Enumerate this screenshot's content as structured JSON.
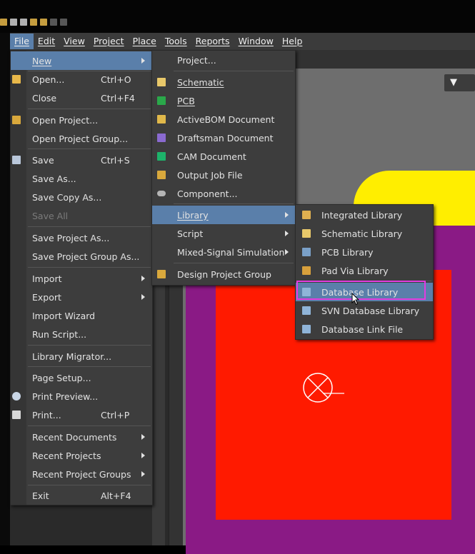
{
  "menubar": {
    "items": [
      "File",
      "Edit",
      "View",
      "Project",
      "Place",
      "Tools",
      "Reports",
      "Window",
      "Help"
    ],
    "active": "File"
  },
  "file_menu": {
    "items": [
      {
        "label": "New",
        "shortcut": "",
        "submenu": true,
        "icon": "",
        "disabled": false
      },
      {
        "label": "Open...",
        "shortcut": "Ctrl+O",
        "submenu": false,
        "icon": "open-folder-icon",
        "disabled": false
      },
      {
        "label": "Close",
        "shortcut": "Ctrl+F4",
        "submenu": false,
        "icon": "",
        "disabled": false
      },
      {
        "label": "Open Project...",
        "shortcut": "",
        "submenu": false,
        "icon": "open-project-icon",
        "disabled": false
      },
      {
        "label": "Open Project Group...",
        "shortcut": "",
        "submenu": false,
        "icon": "",
        "disabled": false
      },
      {
        "label": "Save",
        "shortcut": "Ctrl+S",
        "submenu": false,
        "icon": "save-disk-icon",
        "disabled": false
      },
      {
        "label": "Save As...",
        "shortcut": "",
        "submenu": false,
        "icon": "",
        "disabled": false
      },
      {
        "label": "Save Copy As...",
        "shortcut": "",
        "submenu": false,
        "icon": "",
        "disabled": false
      },
      {
        "label": "Save All",
        "shortcut": "",
        "submenu": false,
        "icon": "",
        "disabled": true
      },
      {
        "label": "Save Project As...",
        "shortcut": "",
        "submenu": false,
        "icon": "",
        "disabled": false
      },
      {
        "label": "Save Project Group As...",
        "shortcut": "",
        "submenu": false,
        "icon": "",
        "disabled": false
      },
      {
        "label": "Import",
        "shortcut": "",
        "submenu": true,
        "icon": "",
        "disabled": false
      },
      {
        "label": "Export",
        "shortcut": "",
        "submenu": true,
        "icon": "",
        "disabled": false
      },
      {
        "label": "Import Wizard",
        "shortcut": "",
        "submenu": false,
        "icon": "",
        "disabled": false
      },
      {
        "label": "Run Script...",
        "shortcut": "",
        "submenu": false,
        "icon": "",
        "disabled": false
      },
      {
        "label": "Library Migrator...",
        "shortcut": "",
        "submenu": false,
        "icon": "",
        "disabled": false
      },
      {
        "label": "Page Setup...",
        "shortcut": "",
        "submenu": false,
        "icon": "",
        "disabled": false
      },
      {
        "label": "Print Preview...",
        "shortcut": "",
        "submenu": false,
        "icon": "print-preview-icon",
        "disabled": false
      },
      {
        "label": "Print...",
        "shortcut": "Ctrl+P",
        "submenu": false,
        "icon": "printer-icon",
        "disabled": false
      },
      {
        "label": "Recent Documents",
        "shortcut": "",
        "submenu": true,
        "icon": "",
        "disabled": false
      },
      {
        "label": "Recent Projects",
        "shortcut": "",
        "submenu": true,
        "icon": "",
        "disabled": false
      },
      {
        "label": "Recent Project Groups",
        "shortcut": "",
        "submenu": true,
        "icon": "",
        "disabled": false
      },
      {
        "label": "Exit",
        "shortcut": "Alt+F4",
        "submenu": false,
        "icon": "",
        "disabled": false
      }
    ]
  },
  "new_menu": {
    "items": [
      {
        "label": "Project...",
        "submenu": false,
        "icon": ""
      },
      {
        "label": "Schematic",
        "submenu": false,
        "icon": "schematic-icon"
      },
      {
        "label": "PCB",
        "submenu": false,
        "icon": "pcb-icon"
      },
      {
        "label": "ActiveBOM Document",
        "submenu": false,
        "icon": "activebom-icon"
      },
      {
        "label": "Draftsman Document",
        "submenu": false,
        "icon": "draftsman-icon"
      },
      {
        "label": "CAM Document",
        "submenu": false,
        "icon": "cam-icon"
      },
      {
        "label": "Output Job File",
        "submenu": false,
        "icon": "output-job-icon"
      },
      {
        "label": "Component...",
        "submenu": false,
        "icon": "component-icon"
      },
      {
        "label": "Library",
        "submenu": true,
        "icon": ""
      },
      {
        "label": "Script",
        "submenu": true,
        "icon": ""
      },
      {
        "label": "Mixed-Signal Simulation",
        "submenu": true,
        "icon": ""
      },
      {
        "label": "Design Project Group",
        "submenu": false,
        "icon": "project-group-icon"
      }
    ]
  },
  "library_menu": {
    "items": [
      {
        "label": "Integrated Library",
        "icon": "integrated-library-icon"
      },
      {
        "label": "Schematic Library",
        "icon": "schematic-library-icon"
      },
      {
        "label": "PCB Library",
        "icon": "pcb-library-icon"
      },
      {
        "label": "Pad Via Library",
        "icon": "pad-via-library-icon"
      },
      {
        "label": "Database Library",
        "icon": "database-library-icon"
      },
      {
        "label": "SVN Database Library",
        "icon": "svn-database-library-icon"
      },
      {
        "label": "Database Link File",
        "icon": "database-link-icon"
      }
    ]
  },
  "colors": {
    "menu_bg": "#3d3d3d",
    "highlight": "#5a7faa",
    "annotation_box": "#e23ce0",
    "canvas_yellow": "#ffee00",
    "canvas_purple": "#8a1a85",
    "canvas_red": "#ff1a00"
  }
}
